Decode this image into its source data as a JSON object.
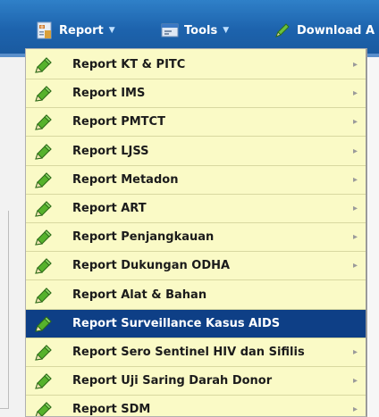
{
  "menubar": {
    "items": [
      {
        "label": "Report",
        "icon": "report-icon"
      },
      {
        "label": "Tools",
        "icon": "tools-icon"
      },
      {
        "label": "Download A",
        "icon": "download-icon"
      }
    ]
  },
  "dropdown": {
    "items": [
      {
        "label": "Report KT & PITC",
        "has_submenu": true
      },
      {
        "label": "Report IMS",
        "has_submenu": true
      },
      {
        "label": "Report PMTCT",
        "has_submenu": true
      },
      {
        "label": "Report LJSS",
        "has_submenu": true
      },
      {
        "label": "Report Metadon",
        "has_submenu": true
      },
      {
        "label": "Report ART",
        "has_submenu": true
      },
      {
        "label": "Report Penjangkauan",
        "has_submenu": true
      },
      {
        "label": "Report Dukungan ODHA",
        "has_submenu": true
      },
      {
        "label": "Report Alat & Bahan",
        "has_submenu": false
      },
      {
        "label": "Report Surveillance Kasus AIDS",
        "has_submenu": false,
        "selected": true
      },
      {
        "label": "Report Sero Sentinel HIV dan Sifilis",
        "has_submenu": true
      },
      {
        "label": "Report Uji Saring Darah Donor",
        "has_submenu": true
      },
      {
        "label": "Report SDM",
        "has_submenu": true
      }
    ]
  },
  "colors": {
    "menubar": "#1d63ad",
    "dropdown_bg": "#fafac6",
    "selected_bg": "#0e3f86",
    "pencil_green": "#3a9a2a"
  }
}
